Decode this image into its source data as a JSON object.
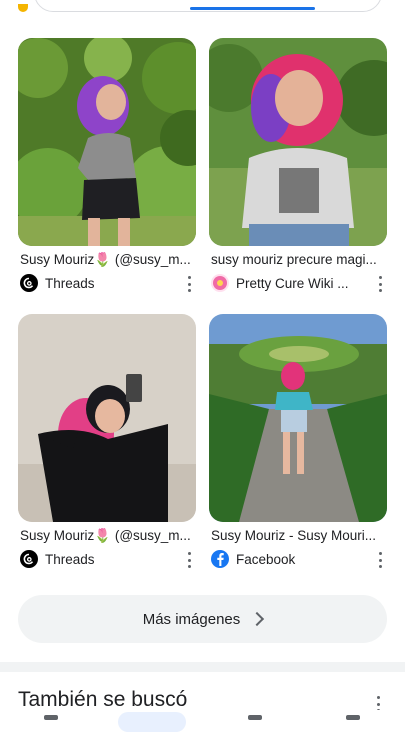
{
  "results": [
    {
      "title": "Susy Mouriz🌷 (@susy_m...",
      "source": "Threads",
      "source_icon": "threads-icon"
    },
    {
      "title": "susy mouriz precure magi...",
      "source": "Pretty Cure Wiki ...",
      "source_icon": "pretty-cure-wiki-icon"
    },
    {
      "title": "Susy Mouriz🌷 (@susy_m...",
      "source": "Threads",
      "source_icon": "threads-icon"
    },
    {
      "title": "Susy Mouriz - Susy Mouri...",
      "source": "Facebook",
      "source_icon": "facebook-icon"
    }
  ],
  "more_images": {
    "label": "Más imágenes"
  },
  "related": {
    "title": "También se buscó"
  },
  "colors": {
    "accent": "#1a73e8",
    "facebook": "#1877f2",
    "threads": "#000000",
    "button_bg": "#f1f3f4"
  }
}
